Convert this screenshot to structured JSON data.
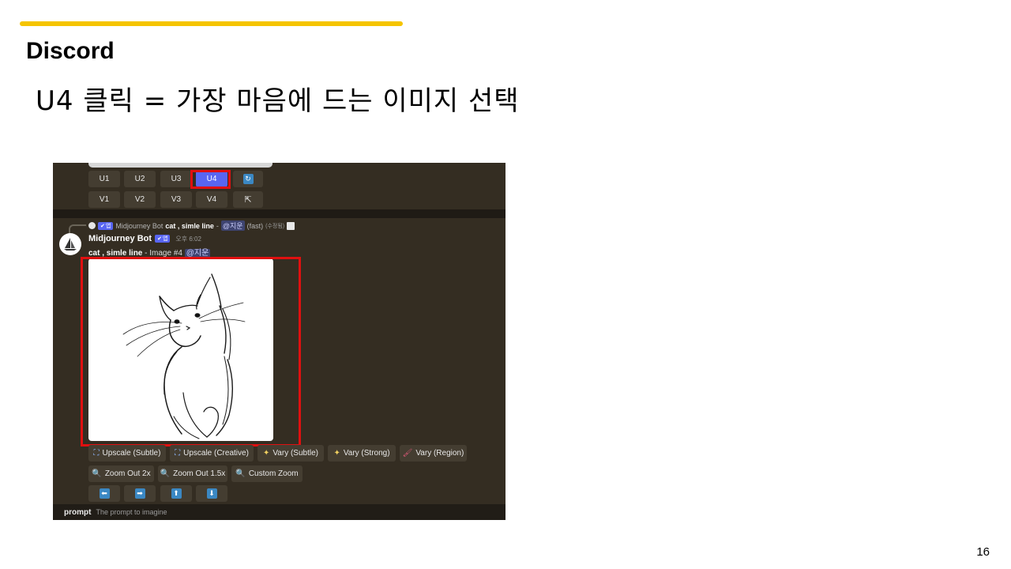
{
  "slide": {
    "title": "Discord",
    "subtitle": "U4 클릭 = 가장 마음에 드는 이미지 선택",
    "page_number": "16",
    "accent_color": "#f5c400"
  },
  "screenshot": {
    "grid_upscale": [
      "U1",
      "U2",
      "U3",
      "U4"
    ],
    "grid_vary": [
      "V1",
      "V2",
      "V3",
      "V4"
    ],
    "active_button": "U4",
    "highlight_color": "#e01010",
    "reply": {
      "author": "Midjourney Bot",
      "badge": "앱",
      "prompt": "cat , simle line",
      "separator": " - ",
      "mention": "@지운",
      "speed": "(fast)",
      "edited": "(수정됨)"
    },
    "message": {
      "author": "Midjourney Bot",
      "badge": "앱",
      "timestamp": "오후 6:02",
      "prompt": "cat , simle line",
      "image_label": " - Image #4 ",
      "mention": "@지운"
    },
    "actions_row1": [
      {
        "icon": "expand-icon",
        "label": "Upscale (Subtle)"
      },
      {
        "icon": "expand-icon",
        "label": "Upscale (Creative)"
      },
      {
        "icon": "magic-wand-icon",
        "label": "Vary (Subtle)"
      },
      {
        "icon": "magic-wand-icon",
        "label": "Vary (Strong)"
      },
      {
        "icon": "paintbrush-icon",
        "label": "Vary (Region)"
      }
    ],
    "actions_row2": [
      {
        "icon": "magnifier-icon",
        "label": "Zoom Out 2x"
      },
      {
        "icon": "magnifier-icon",
        "label": "Zoom Out 1.5x"
      },
      {
        "icon": "magnifier-icon",
        "label": "Custom Zoom"
      }
    ],
    "pan_arrows": [
      {
        "icon": "arrow-left-icon",
        "glyph": "⬅"
      },
      {
        "icon": "arrow-right-icon",
        "glyph": "➡"
      },
      {
        "icon": "arrow-up-icon",
        "glyph": "⬆"
      },
      {
        "icon": "arrow-down-icon",
        "glyph": "⬇"
      }
    ],
    "prompt_bar": {
      "label": "prompt",
      "hint": "The prompt to imagine"
    }
  }
}
